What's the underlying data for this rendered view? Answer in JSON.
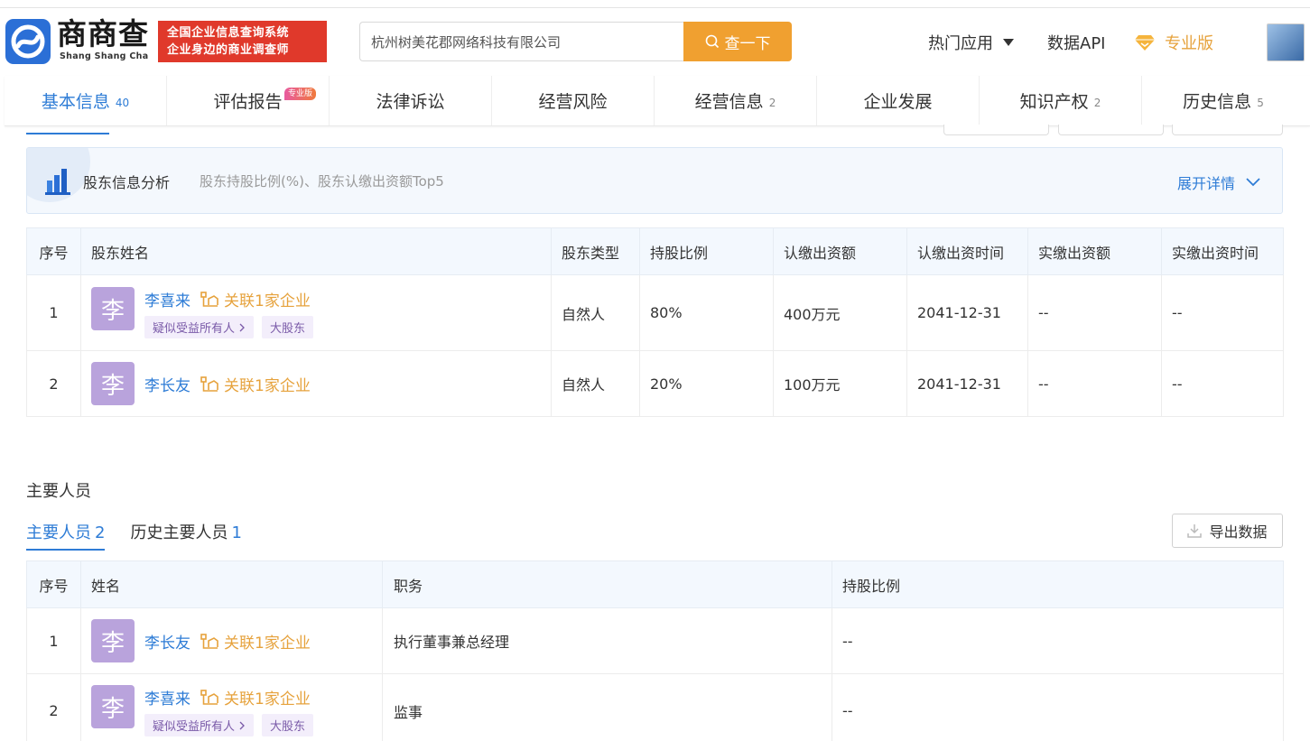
{
  "header": {
    "brand_cn": "商商查",
    "brand_en": "Shang Shang Cha",
    "slogan_line1": "全国企业信息查询系统",
    "slogan_line2": "企业身边的商业调查师",
    "search_value": "杭州树美花郡网络科技有限公司",
    "search_button": "查一下",
    "nav_hot": "热门应用",
    "nav_api": "数据API",
    "nav_pro": "专业版"
  },
  "tabs": [
    {
      "label": "基本信息",
      "count": "40"
    },
    {
      "label": "评估报告",
      "count": "",
      "badge": "专业版"
    },
    {
      "label": "法律诉讼",
      "count": ""
    },
    {
      "label": "经营风险",
      "count": ""
    },
    {
      "label": "经营信息",
      "count": "2"
    },
    {
      "label": "企业发展",
      "count": ""
    },
    {
      "label": "知识产权",
      "count": "2"
    },
    {
      "label": "历史信息",
      "count": "5"
    }
  ],
  "analysis": {
    "title": "股东信息分析",
    "subtitle": "股东持股比例(%)、股东认缴出资额Top5",
    "expand": "展开详情"
  },
  "shareholders": {
    "headers": [
      "序号",
      "股东姓名",
      "股东类型",
      "持股比例",
      "认缴出资额",
      "认缴出资时间",
      "实缴出资额",
      "实缴出资时间"
    ],
    "rows": [
      {
        "no": "1",
        "avatar": "李",
        "name": "李喜来",
        "related": "关联1家企业",
        "tags": [
          "疑似受益所有人",
          "大股东"
        ],
        "type": "自然人",
        "ratio": "80%",
        "subscribed": "400万元",
        "sub_date": "2041-12-31",
        "paid": "--",
        "paid_date": "--"
      },
      {
        "no": "2",
        "avatar": "李",
        "name": "李长友",
        "related": "关联1家企业",
        "tags": [],
        "type": "自然人",
        "ratio": "20%",
        "subscribed": "100万元",
        "sub_date": "2041-12-31",
        "paid": "--",
        "paid_date": "--"
      }
    ]
  },
  "personnel": {
    "section_title": "主要人员",
    "subtab_main": "主要人员",
    "subtab_main_count": "2",
    "subtab_hist": "历史主要人员",
    "subtab_hist_count": "1",
    "export": "导出数据",
    "headers": [
      "序号",
      "姓名",
      "职务",
      "持股比例"
    ],
    "rows": [
      {
        "no": "1",
        "avatar": "李",
        "name": "李长友",
        "related": "关联1家企业",
        "tags": [],
        "title": "执行董事兼总经理",
        "ratio": "--"
      },
      {
        "no": "2",
        "avatar": "李",
        "name": "李喜来",
        "related": "关联1家企业",
        "tags": [
          "疑似受益所有人",
          "大股东"
        ],
        "title": "监事",
        "ratio": "--"
      }
    ]
  },
  "colors": {
    "accent": "#2e7cd6",
    "orange": "#e6a23c",
    "search_btn": "#f0a030",
    "slogan_bg": "#e0392b",
    "avatar_bg": "#b9a3dc"
  },
  "icons": [
    "logo-icon",
    "search-icon",
    "caret-down-icon",
    "diamond-icon",
    "bar-chart-icon",
    "chevron-down-icon",
    "related-company-icon",
    "chevron-right-icon",
    "download-icon"
  ]
}
